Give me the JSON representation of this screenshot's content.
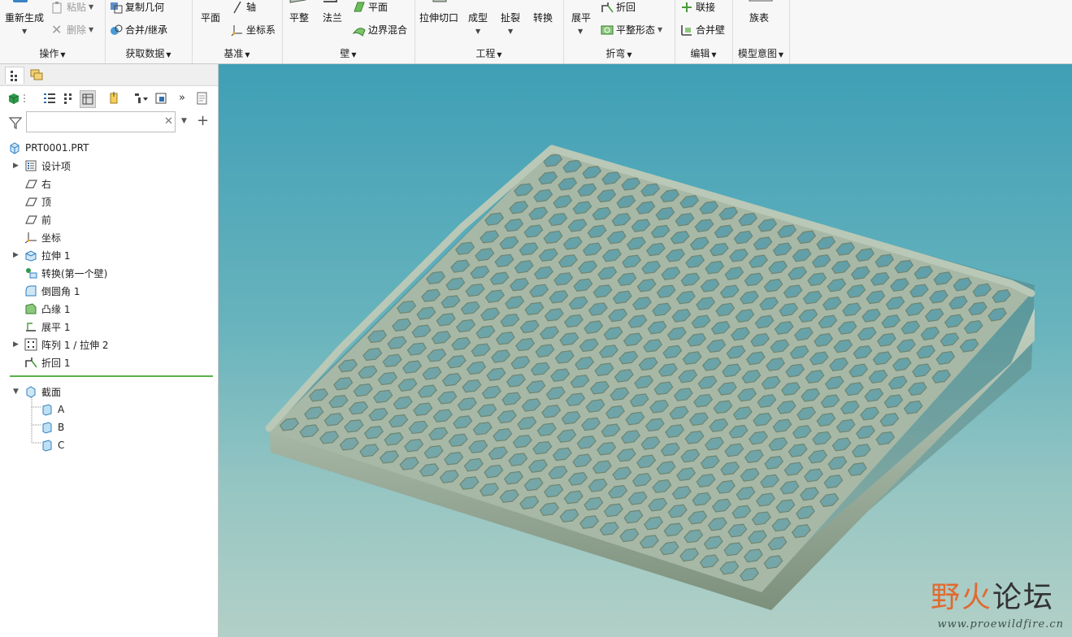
{
  "ribbon": {
    "operations": {
      "label": "操作",
      "regenerate": "重新生成",
      "paste": "粘贴",
      "delete": "删除"
    },
    "get_data": {
      "label": "获取数据",
      "copy_geometry": "复制几何",
      "merge_inherit": "合并/继承"
    },
    "datum": {
      "label": "基准",
      "plane": "平面",
      "axis": "轴",
      "csys": "坐标系"
    },
    "wall": {
      "label": "壁",
      "flat": "平整",
      "flange": "法兰",
      "planar": "平面",
      "boundary_blend": "边界混合"
    },
    "engineering": {
      "label": "工程",
      "extrude_cut": "拉伸切口",
      "form": "成型",
      "rip": "扯裂",
      "convert": "转换"
    },
    "bend": {
      "label": "折弯",
      "unbend": "展平",
      "bend_back": "折回",
      "flatten_form": "平整形态"
    },
    "edit": {
      "label": "编辑",
      "join": "联接",
      "merge_walls": "合并壁"
    },
    "model_intent": {
      "label": "模型意图",
      "family_table": "族表"
    }
  },
  "search": {
    "value": "",
    "placeholder": ""
  },
  "tree": {
    "root": "PRT0001.PRT",
    "items": [
      {
        "label": "设计项",
        "icon": "design-items-icon"
      },
      {
        "label": "右",
        "icon": "datum-plane-icon"
      },
      {
        "label": "顶",
        "icon": "datum-plane-icon"
      },
      {
        "label": "前",
        "icon": "datum-plane-icon"
      },
      {
        "label": "坐标",
        "icon": "csys-icon"
      },
      {
        "label": "拉伸 1",
        "icon": "extrude-icon"
      },
      {
        "label": "转换(第一个壁)",
        "icon": "convert-icon"
      },
      {
        "label": "倒圆角 1",
        "icon": "round-icon"
      },
      {
        "label": "凸缘 1",
        "icon": "flange-icon"
      },
      {
        "label": "展平 1",
        "icon": "unbend-icon"
      },
      {
        "label": "阵列 1 / 拉伸 2",
        "icon": "pattern-icon"
      },
      {
        "label": "折回 1",
        "icon": "bend-back-icon"
      }
    ],
    "sections_label": "截面",
    "sections": [
      "A",
      "B",
      "C"
    ]
  },
  "watermark": {
    "brand_part1": "野火",
    "brand_part2": "论坛",
    "url": "www.proewildfire.cn"
  },
  "colors": {
    "model": "#a7b8a6",
    "model_shadow": "#6f8570",
    "viewport_top": "#3f9fb6",
    "viewport_bottom": "#b2d0c7",
    "insert_line": "#5ab24b"
  }
}
